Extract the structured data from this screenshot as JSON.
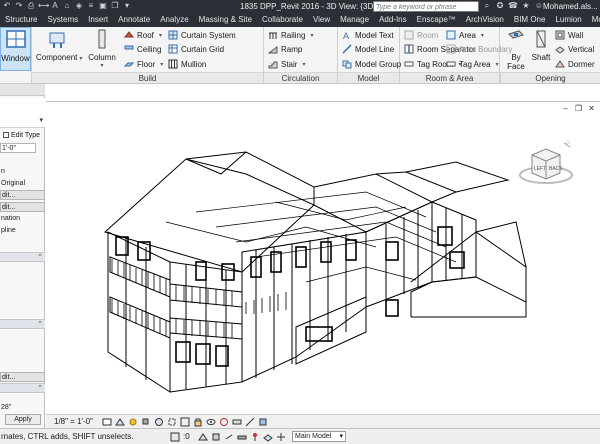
{
  "titlebar": {
    "title": "1835 DPP_Revit 2016 - 3D View: {3D}",
    "search_placeholder": "Type a keyword or phrase",
    "user": "Mohamed.als..."
  },
  "tabs": [
    {
      "label": "Structure"
    },
    {
      "label": "Systems"
    },
    {
      "label": "Insert"
    },
    {
      "label": "Annotate"
    },
    {
      "label": "Analyze"
    },
    {
      "label": "Massing & Site"
    },
    {
      "label": "Collaborate"
    },
    {
      "label": "View"
    },
    {
      "label": "Manage"
    },
    {
      "label": "Add-Ins"
    },
    {
      "label": "Enscape™"
    },
    {
      "label": "ArchVision"
    },
    {
      "label": "BIM One"
    },
    {
      "label": "Lumion"
    },
    {
      "label": "Modify"
    }
  ],
  "ribbon": {
    "window_label": "Window",
    "build": {
      "title": "Build",
      "component": "Component",
      "column": "Column",
      "roof": "Roof",
      "ceiling": "Ceiling",
      "floor": "Floor",
      "curtain_system": "Curtain System",
      "curtain_grid": "Curtain Grid",
      "mullion": "Mullion"
    },
    "circulation": {
      "title": "Circulation",
      "railing": "Railing",
      "ramp": "Ramp",
      "stair": "Stair"
    },
    "model": {
      "title": "Model",
      "model_text": "Model Text",
      "model_line": "Model Line",
      "model_group": "Model Group"
    },
    "room_area": {
      "title": "Room & Area",
      "room": "Room",
      "room_separator": "Room Separator",
      "tag_room": "Tag Room",
      "area": "Area",
      "area_boundary": "Area Boundary",
      "tag_area": "Tag Area"
    },
    "opening": {
      "title": "Opening",
      "by_face_1": "By",
      "by_face_2": "Face",
      "shaft": "Shaft",
      "wall": "Wall",
      "vertical": "Vertical",
      "dormer": "Dormer"
    }
  },
  "properties": {
    "edit_type": "Edit Type",
    "scale_value": "1'-0\"",
    "rows": [
      "n",
      "Original",
      "dit...",
      "dit...",
      "nation",
      "pline"
    ],
    "lower_rows": [
      "dit...",
      "28\""
    ],
    "apply": "Apply"
  },
  "viewport": {
    "viewcube_front": "LEFT",
    "viewcube_side": "BACK"
  },
  "viewbar": {
    "scale": "1/8\" = 1'-0\""
  },
  "status": {
    "text": "rnates, CTRL adds, SHIFT unselects.",
    "zero": ":0",
    "model": "Main Model"
  },
  "colors": {
    "dark": "#2b2f36",
    "ribbon": "#f4f4f4",
    "accent_blue": "#2f6db5",
    "selected": "#cde4f7"
  }
}
